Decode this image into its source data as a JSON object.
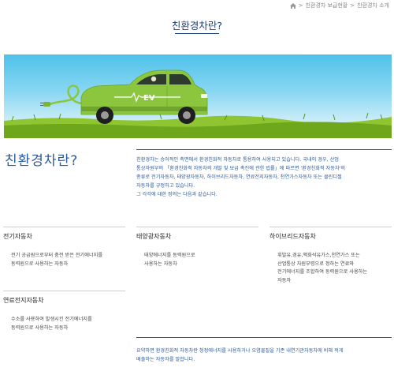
{
  "breadcrumb": {
    "sep": ">",
    "items": [
      "친환경차 보급현황",
      "친환경차 소개"
    ]
  },
  "page_title": "친환경차란?",
  "hero": {
    "badge": "EV"
  },
  "intro": {
    "heading": "친환경차란?",
    "lines": [
      "친환경차는 승어적인 측면에서 환경친화적 자동차로 통용하여 사용되고 있습니다. 국내의 경우, 산업",
      "통상자원부의 「환경친화적 자동차의 개발 및 보급 촉진에 관한 법률」에 따르면 '환경친화적 자동차'의",
      "종류로 전기자동차, 태양광자동차, 하이브리드자동차, 연료전지자동차, 천연가스자동차 또는 클린디젤",
      "자동차를 규정하고 있습니다.",
      "그 각각에 대한 정의는 다음과 같습니다."
    ]
  },
  "cards": [
    {
      "title": "전기자동차",
      "lines": [
        "전기 공급원으로부터 충전 받은 전기에너지를",
        "동력원으로 사용하는 자동차"
      ]
    },
    {
      "title": "태양광자동차",
      "lines": [
        "태양에너지를 동력원으로",
        "사용하는 자동차"
      ]
    },
    {
      "title": "하이브리드자동차",
      "lines": [
        "휘발유,경유,액화석유가스,천연가스 또는",
        "산업통상 자원부령으로 정하는 연료와",
        "전기에너지를 조합하여 동력원으로 사용하는",
        "자동차"
      ]
    },
    {
      "title": "연료전지자동차",
      "lines": [
        "수소를 사용하여 발생시킨 전기에너지를",
        "동력원으로 사용하는 자동차"
      ]
    }
  ],
  "summary": {
    "lines": [
      "요약하면 환경친화적 자동차란 청정에너지를 사용하거나 오염물질을 기존 내연기관자동차에 비해 적게",
      "배출하는 자동차를 말합니다."
    ]
  },
  "colors": {
    "accent": "#2a5aa0",
    "title": "#1f3f75",
    "car": "#8cc63f",
    "grass": "#7fb51f"
  }
}
